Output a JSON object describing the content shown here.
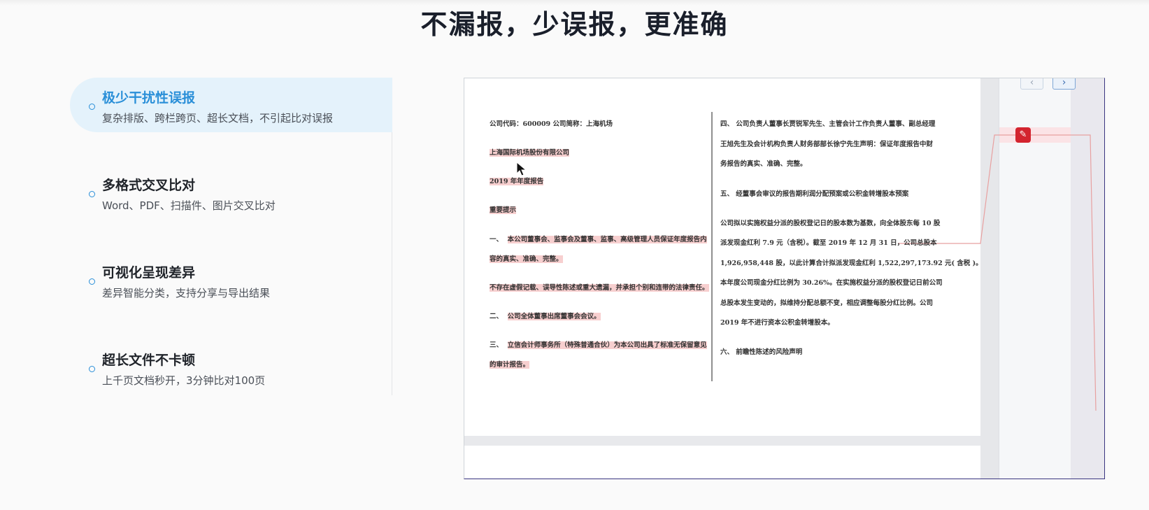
{
  "page": {
    "title": "不漏报，少误报，更准确"
  },
  "features": [
    {
      "title": "极少干扰性误报",
      "desc": "复杂排版、跨栏跨页、超长文档，不引起比对误报",
      "active": true
    },
    {
      "title": "多格式交叉比对",
      "desc": "Word、PDF、扫描件、图片交叉比对",
      "active": false
    },
    {
      "title": "可视化呈现差异",
      "desc": "差异智能分类，支持分享与导出结果",
      "active": false
    },
    {
      "title": "超长文件不卡顿",
      "desc": "上千页文档秒开，3分钟比对100页",
      "active": false
    }
  ],
  "viewer": {
    "nav_prev_icon": "chevron-left-icon",
    "nav_next_icon": "chevron-right-icon",
    "edit_icon": "pencil-icon",
    "left_column": {
      "header": "公司代码：600009  公司简称：上海机场",
      "company": "上海国际机场股份有限公司",
      "report": "2019 年年度报告",
      "notice": "重要提示",
      "item1_num": "一、",
      "item1_a": "本公司董事会、监事会及董事、监事、高级管理人员保证年度报告内",
      "item1_b": "容的真实、准确、完整。",
      "item1_c": "不存在虚假记载、误导性陈述或重大遗漏，并承担个别和连带的法律责任。",
      "item2_num": "二、",
      "item2": "公司全体董事出席董事会会议。",
      "item3_num": "三、",
      "item3_a": "立信会计师事务所（特殊普通合伙）为本公司出具了标准无保留意见",
      "item3_b": "的审计报告。"
    },
    "right_column": {
      "item4_num": "四、",
      "item4_a": "公司负责人董事长贾锐军先生、主管会计工作负责人董事、副总经理",
      "item4_b": "王旭先生及会计机构负责人财务部部长徐宁先生声明：保证年度报告中财",
      "item4_c": "务报告的真实、准确、完整。",
      "item5": "五、  经董事会审议的报告期利润分配预案或公积金转增股本预案",
      "p1": "公司拟以实施权益分派的股权登记日的股本数为基数，向全体股东每 10 股",
      "p2": "派发现金红利 7.9 元（含税）。截至 2019 年 12 月 31 日，公司总股本",
      "p3": "1,926,958,448 股，以此计算合计拟派发现金红利 1,522,297,173.92 元( 含税 )。",
      "p4": "本年度公司现金分红比例为 30.26%。在实施权益分派的股权登记日前公司",
      "p5": "总股本发生变动的，拟维持分配总额不变，相应调整每股分红比例。公司",
      "p6": "2019 年不进行资本公积金转增股本。",
      "item6": "六、  前瞻性陈述的风险声明"
    }
  }
}
